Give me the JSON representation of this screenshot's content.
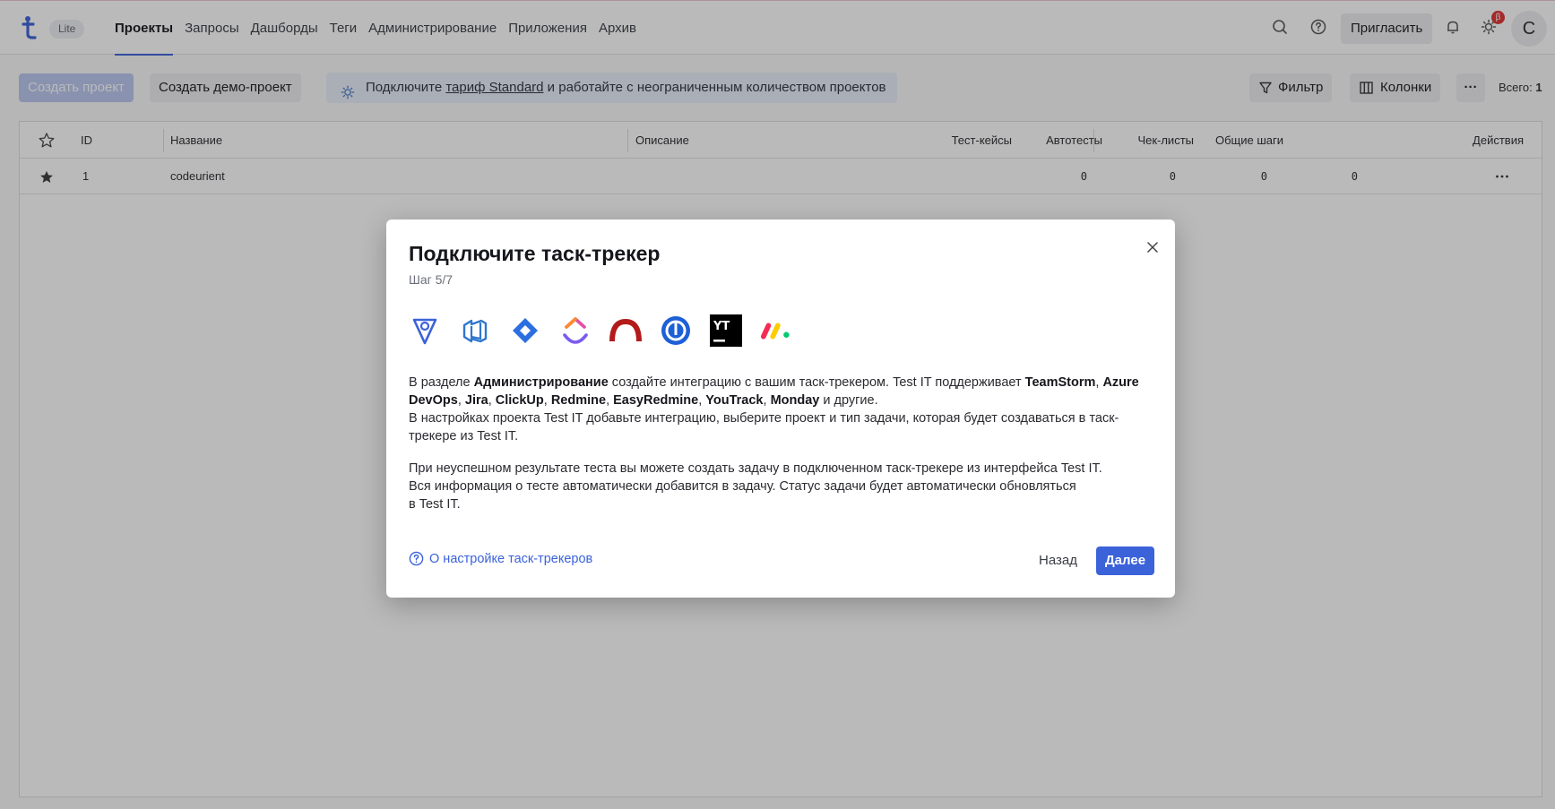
{
  "header": {
    "plan_badge": "Lite",
    "nav": [
      {
        "label": "Проекты"
      },
      {
        "label": "Запросы"
      },
      {
        "label": "Дашборды"
      },
      {
        "label": "Теги"
      },
      {
        "label": "Администрирование"
      },
      {
        "label": "Приложения"
      },
      {
        "label": "Архив"
      }
    ],
    "invite_label": "Пригласить",
    "beta_badge": "β",
    "avatar_initial": "С",
    "icons": [
      "search-icon",
      "help-icon",
      "bell-icon",
      "sun-icon"
    ]
  },
  "toolbar": {
    "create_project": "Создать проект",
    "create_demo": "Создать демо-проект",
    "promo_before": "Подключите ",
    "promo_link": "тариф Standard",
    "promo_after": " и работайте с неограниченным количеством проектов",
    "filter_label": "Фильтр",
    "columns_label": "Колонки",
    "more_label": "···",
    "total_label": "Всего:",
    "total_value": "1"
  },
  "table": {
    "columns": [
      "ID",
      "Название",
      "Описание",
      "Тест-кейсы",
      "Автотесты",
      "Чек-листы",
      "Общие шаги",
      "Действия"
    ],
    "rows": [
      {
        "id": "1",
        "name": "codeurient",
        "description": "",
        "test_cases": "0",
        "autotests": "0",
        "checklists": "0",
        "shared_steps": "0",
        "favorite": true
      }
    ]
  },
  "modal": {
    "title": "Подключите таск-трекер",
    "step": "Шаг 5/7",
    "logos": [
      "teamstorm-icon",
      "azure-devops-icon",
      "jira-icon",
      "clickup-icon",
      "redmine-icon",
      "easyredmine-icon",
      "youtrack-icon",
      "monday-icon"
    ],
    "youtrack_logo_text": "YT",
    "p1": {
      "t1": "В разделе ",
      "b1": "Администрирование",
      "t2": " создайте интеграцию с вашим таск-трекером. Test IT поддерживает ",
      "b2": "TeamStorm",
      "t3": ", ",
      "b3": "Azure DevOps",
      "t4": ", ",
      "b4": "Jira",
      "t5": ", ",
      "b5": "ClickUp",
      "t6": ", ",
      "b6": "Redmine",
      "t7": ", ",
      "b7": "EasyRedmine",
      "t8": ", ",
      "b8": "YouTrack",
      "t9": ", ",
      "b9": "Monday",
      "t10": " и другие.",
      "line2": "В настройках проекта Test IT добавьте интеграцию, выберите проект и тип задачи, которая будет создаваться в таск-трекере из Test IT."
    },
    "p2": {
      "line1": "При неуспешном результате теста вы можете создать задачу в подключенном таск-трекере из интерфейса Test IT.",
      "line2": "Вся информация о тесте автоматически добавится в задачу. Статус задачи будет автоматически обновляться",
      "line3": "в Test IT."
    },
    "help_link": "О настройке таск-трекеров",
    "back_label": "Назад",
    "next_label": "Далее"
  }
}
